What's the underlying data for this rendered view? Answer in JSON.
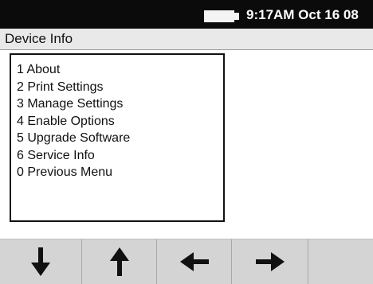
{
  "status_bar": {
    "clock": "9:17AM Oct 16 08",
    "battery_icon": "battery-icon"
  },
  "title_bar": {
    "title": "Device Info"
  },
  "menu": {
    "items": [
      {
        "label": "1 About"
      },
      {
        "label": "2 Print Settings"
      },
      {
        "label": "3 Manage Settings"
      },
      {
        "label": "4 Enable Options"
      },
      {
        "label": "5 Upgrade Software"
      },
      {
        "label": "6 Service Info"
      },
      {
        "label": "0 Previous Menu"
      }
    ]
  },
  "softkeys": [
    {
      "icon": "arrow-down-icon"
    },
    {
      "icon": "arrow-up-icon"
    },
    {
      "icon": "arrow-left-icon"
    },
    {
      "icon": "arrow-right-icon"
    },
    {
      "icon": ""
    }
  ]
}
